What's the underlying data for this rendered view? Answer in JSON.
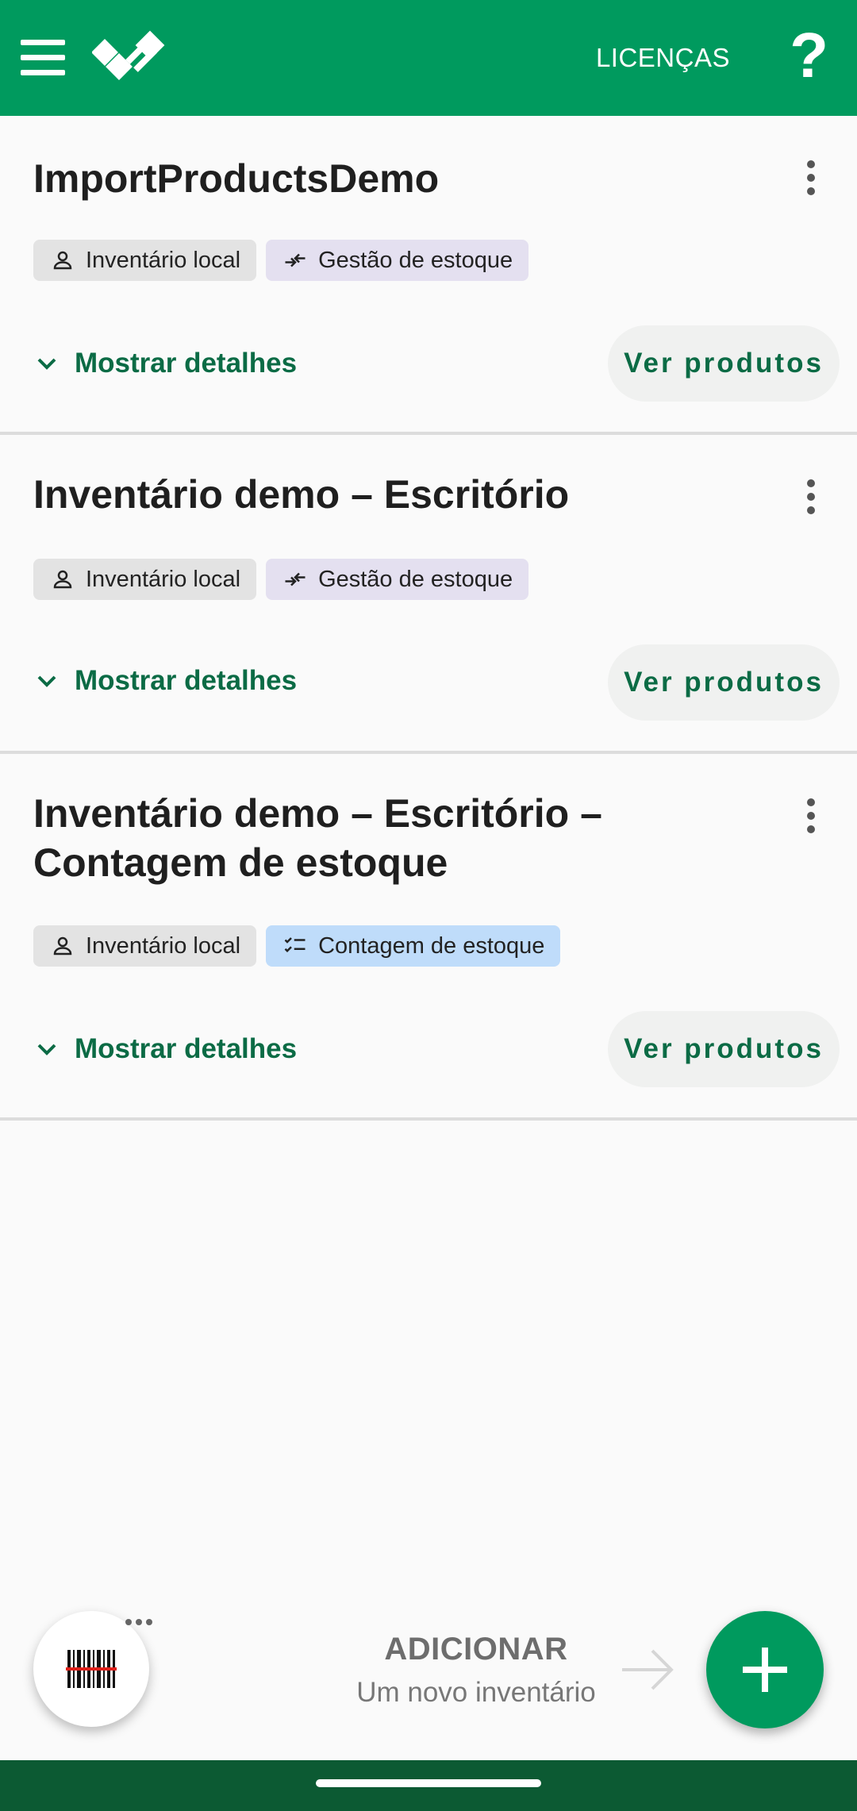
{
  "app_bar": {
    "licenses_label": "LICENÇAS",
    "help_label": "?",
    "menu_icon": "hamburger-menu-icon",
    "logo_icon": "app-logo-icon",
    "background_color": "#009a5e"
  },
  "inventories": [
    {
      "title": "ImportProductsDemo",
      "tags": [
        {
          "icon": "person-icon",
          "label": "Inventário local",
          "color": "#e3e3e3"
        },
        {
          "icon": "stock-management-icon",
          "label": "Gestão de estoque",
          "color": "#e4e0f0"
        }
      ],
      "details_label": "Mostrar detalhes",
      "view_products_label": "Ver produtos"
    },
    {
      "title": "Inventário demo – Escritório",
      "tags": [
        {
          "icon": "person-icon",
          "label": "Inventário local",
          "color": "#e3e3e3"
        },
        {
          "icon": "stock-management-icon",
          "label": "Gestão de estoque",
          "color": "#e4e0f0"
        }
      ],
      "details_label": "Mostrar detalhes",
      "view_products_label": "Ver produtos"
    },
    {
      "title": "Inventário demo – Escritório – Contagem de estoque",
      "tags": [
        {
          "icon": "person-icon",
          "label": "Inventário local",
          "color": "#e3e3e3"
        },
        {
          "icon": "checklist-icon",
          "label": "Contagem de estoque",
          "color": "#bfdcfa"
        }
      ],
      "details_label": "Mostrar detalhes",
      "view_products_label": "Ver produtos"
    }
  ],
  "bottom": {
    "scan_icon": "barcode-scan-icon",
    "add_title": "ADICIONAR",
    "add_subtitle": "Um novo inventário",
    "add_icon": "plus-icon",
    "accent_color": "#0b6b45"
  }
}
